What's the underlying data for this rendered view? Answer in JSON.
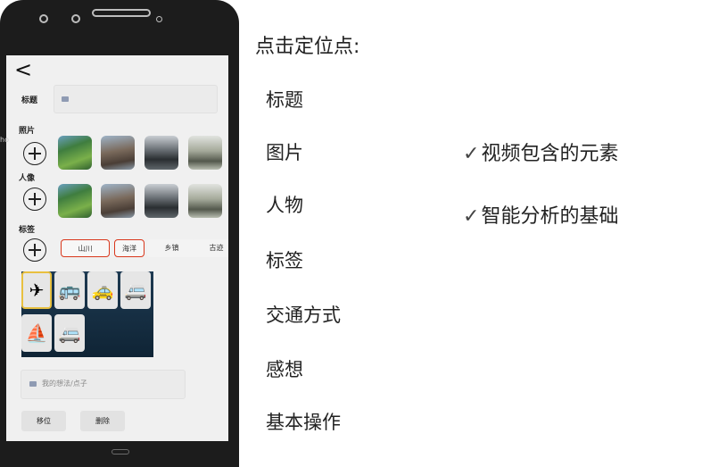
{
  "phone": {
    "back_glyph": "<",
    "title_label": "标题",
    "photo_label": "照片",
    "person_label": "人像",
    "tag_label": "标签",
    "tags": [
      "山川",
      "海洋",
      "乡镇",
      "古迹"
    ],
    "thought_placeholder": "我的想法/点子",
    "move_button": "移位",
    "delete_button": "删除",
    "edge_text": "ho",
    "vehicle_icons": [
      "airplane-icon",
      "bus-icon",
      "taxi-icon",
      "van-icon",
      "sailboat-icon",
      "minibus-icon"
    ],
    "accent_color": "#d9371c"
  },
  "right": {
    "heading": "点击定位点:",
    "items": [
      "标题",
      "图片",
      "人物",
      "标签",
      "交通方式",
      "感想",
      "基本操作"
    ],
    "check_glyph": "✓",
    "features": [
      "视频包含的元素",
      "智能分析的基础"
    ]
  }
}
